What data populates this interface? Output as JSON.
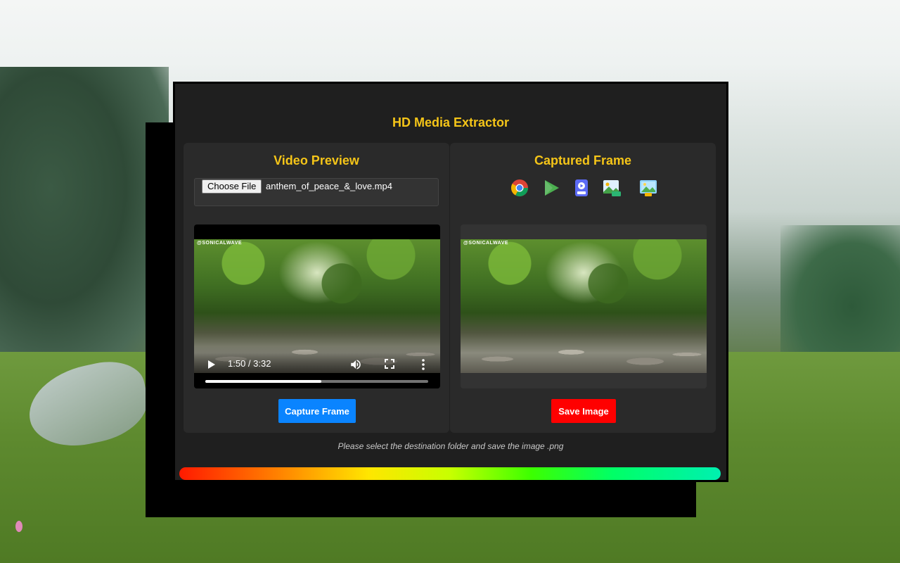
{
  "app": {
    "title": "HD Media Extractor"
  },
  "video_panel": {
    "title": "Video Preview",
    "file_input": {
      "button_label": "Choose File",
      "file_name": "anthem_of_peace_&_love.mp4"
    },
    "player": {
      "watermark": "@SONICALWAVE",
      "time_display": "1:50 / 3:32",
      "progress": 0.52
    },
    "capture_button_label": "Capture Frame"
  },
  "frame_panel": {
    "title": "Captured Frame",
    "icons": [
      "chrome-icon",
      "play-store-icon",
      "mp4-file-icon",
      "png-image-icon",
      "hd-image-icon"
    ],
    "watermark": "@SONICALWAVE",
    "save_button_label": "Save Image"
  },
  "footer": {
    "note": "Please select the destination folder and save the image .png"
  },
  "colors": {
    "accent_title": "#f5c518",
    "capture_button": "#0a84ff",
    "save_button": "#ff0000",
    "panel_bg": "#2a2a2a",
    "app_bg": "#1f1f1f"
  }
}
